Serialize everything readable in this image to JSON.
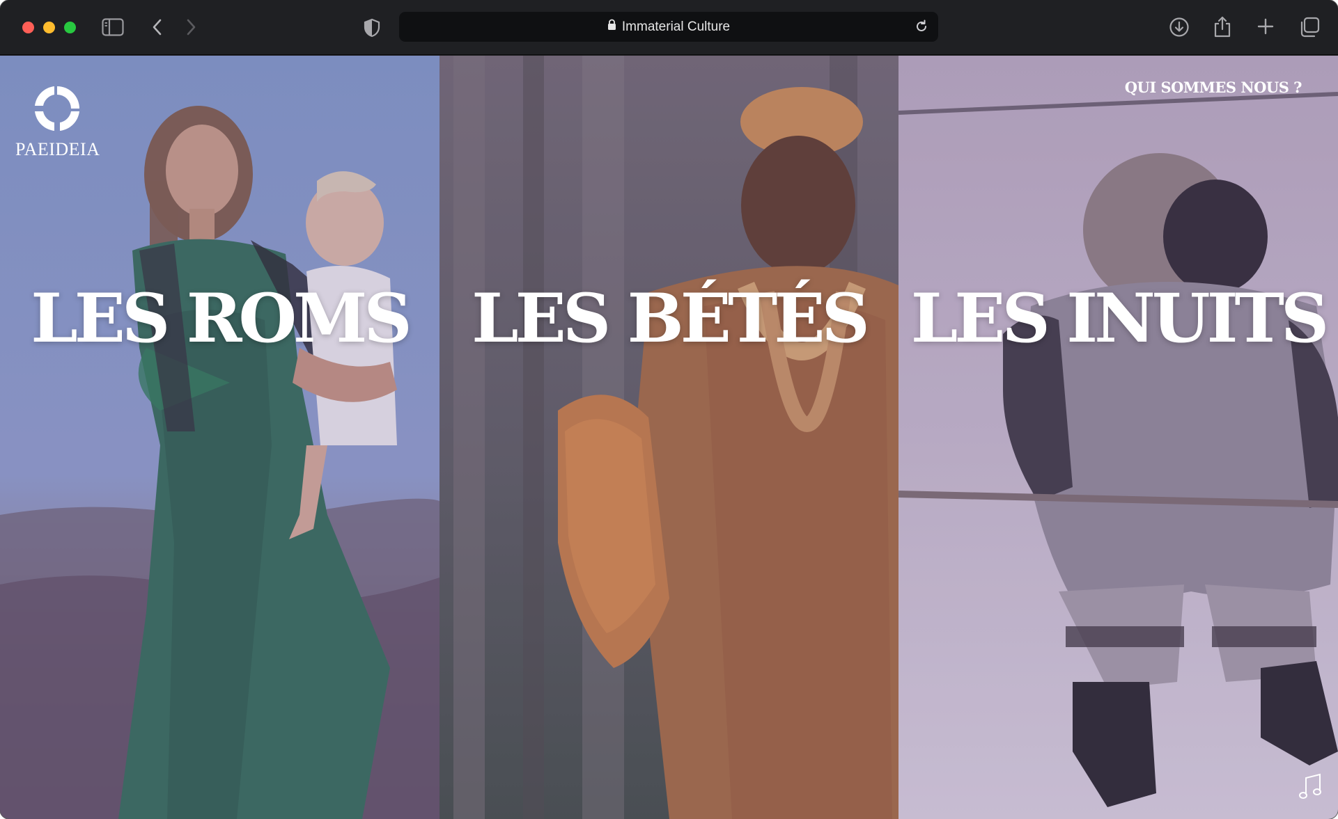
{
  "browser": {
    "url_title": "Immaterial Culture",
    "icons": {
      "sidebar": "sidebar-icon",
      "back": "chevron-left-icon",
      "forward": "chevron-right-icon",
      "privacy": "shield-icon",
      "lock": "lock-icon",
      "reload": "reload-icon",
      "download": "download-icon",
      "share": "share-icon",
      "new_tab": "plus-icon",
      "tabs": "tabs-overview-icon"
    }
  },
  "site": {
    "logo_text": "PAEIDEIA",
    "about_link": "QUI SOMMES NOUS ?",
    "music_icon": "music-note-icon"
  },
  "panels": [
    {
      "title": "LES ROMS"
    },
    {
      "title": "LES BÉTÉS"
    },
    {
      "title": "LES INUITS"
    }
  ],
  "colors": {
    "traffic_red": "#ff5f57",
    "traffic_yellow": "#febc2e",
    "traffic_green": "#28c840",
    "toolbar": "#1f2023",
    "title_text": "#ffffff"
  }
}
